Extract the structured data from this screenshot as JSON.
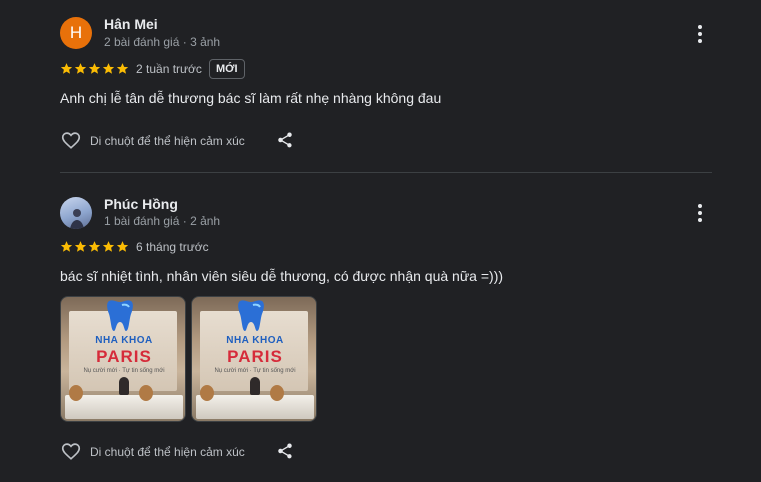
{
  "reviews": [
    {
      "avatar_letter": "H",
      "name": "Hân Mei",
      "meta": "2 bài đánh giá · 3 ảnh",
      "rating": 5,
      "when": "2 tuần trước",
      "badge": "MỚI",
      "text": "Anh chị lễ tân dễ thương bác sĩ làm rất nhẹ nhàng không đau",
      "react_label": "Di chuột để thể hiện cảm xúc"
    },
    {
      "name": "Phúc Hồng",
      "meta": "1 bài đánh giá · 2 ảnh",
      "rating": 5,
      "when": "6 tháng trước",
      "text": "bác sĩ nhiệt tình, nhân viên siêu dễ thương, có được nhận quà nữa =)))",
      "photos": [
        {
          "line1": "NHA KHOA",
          "line2": "PARIS",
          "line3": "Nụ cười mới · Tự tin sống mới"
        },
        {
          "line1": "NHA KHOA",
          "line2": "PARIS",
          "line3": "Nụ cười mới · Tự tin sống mới"
        }
      ],
      "react_label": "Di chuột để thể hiện cảm xúc"
    }
  ],
  "icons": {
    "star": "star-icon",
    "more": "more-vert-icon",
    "like": "heart-icon",
    "share": "share-icon"
  },
  "colors": {
    "background": "#202124",
    "star": "#fbbc04",
    "avatar_h": "#e8710a"
  }
}
